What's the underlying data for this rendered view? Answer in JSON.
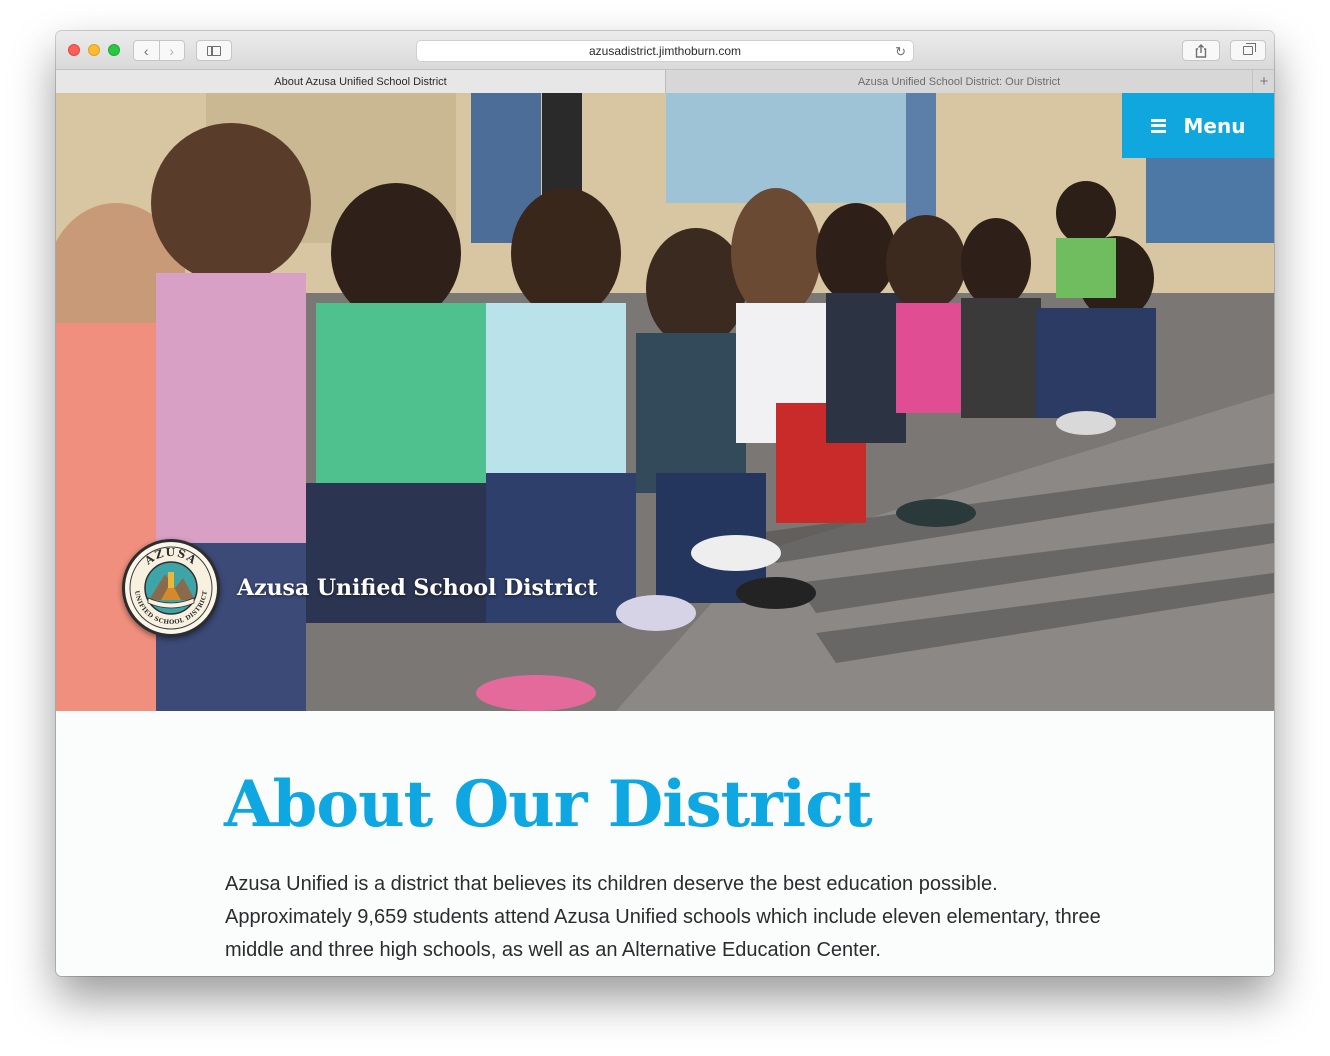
{
  "browser": {
    "url": "azusadistrict.jimthoburn.com",
    "tabs": [
      {
        "title": "About Azusa Unified School District",
        "active": true
      },
      {
        "title": "Azusa Unified School District: Our District",
        "active": false
      }
    ],
    "new_tab_glyph": "+",
    "back_glyph": "‹",
    "forward_glyph": "›",
    "reload_glyph": "↻"
  },
  "site": {
    "name": "Azusa Unified School District",
    "menu_label": "Menu",
    "seal_top_text": "AZUSA",
    "seal_bottom_text": "UNIFIED SCHOOL DISTRICT",
    "seal_ribbon_text": "Excellence in Education"
  },
  "page": {
    "title": "About Our District",
    "intro": "Azusa Unified is a district that believes its children deserve the best education possible. Approximately 9,659 students attend Azusa Unified schools which include eleven elementary, three middle and three high schools, as well as an Alternative Education Center."
  },
  "colors": {
    "accent": "#0ea7e1",
    "menu_bg": "#10a7de",
    "body_text": "#2a2c2e"
  },
  "icons": [
    "back-icon",
    "forward-icon",
    "sidebar-icon",
    "reload-icon",
    "share-icon",
    "tabs-overview-icon",
    "new-tab-icon",
    "hamburger-icon"
  ]
}
